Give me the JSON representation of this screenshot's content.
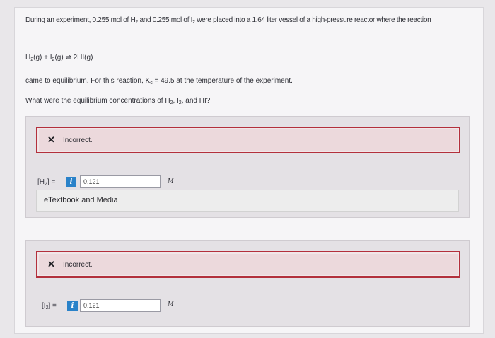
{
  "question": {
    "intro_a": "During an experiment, 0.255 mol of H",
    "intro_b": " and 0.255 mol of I",
    "intro_c": " were placed into a 1.64 liter vessel of a high-pressure reactor where the reaction",
    "sub2": "2",
    "eq_h": "H",
    "eq_h_state": "(g) + I",
    "eq_i_state": "(g) ⇌ 2HI(g)",
    "line3": "came to equilibrium. For this reaction, K",
    "line3_sub": "c",
    "line3_end": " = 49.5 at the temperature of the experiment.",
    "line4_a": "What were the equilibrium concentrations of H",
    "line4_b": ", I",
    "line4_c": ", and HI?"
  },
  "answers": [
    {
      "feedback": "Incorrect.",
      "label_a": "[H",
      "label_b": "] =",
      "value": "0.121",
      "unit": "M",
      "info_icon": "i"
    },
    {
      "feedback": "Incorrect.",
      "label_a": "[I",
      "label_b": "] =",
      "value": "0.121",
      "unit": "M",
      "info_icon": "i"
    }
  ],
  "etextbook": "eTextbook and Media",
  "colors": {
    "error_border": "#b3303c",
    "info_blue": "#2a82c9"
  }
}
